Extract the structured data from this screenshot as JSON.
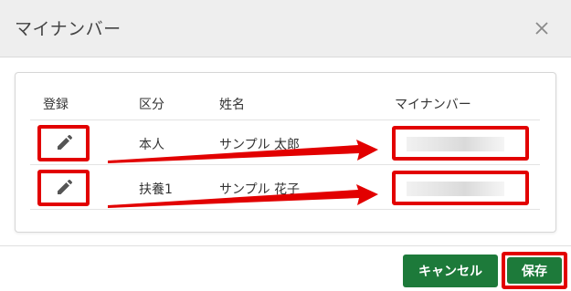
{
  "dialog": {
    "title": "マイナンバー"
  },
  "table": {
    "headers": {
      "register": "登録",
      "category": "区分",
      "name": "姓名",
      "mynumber": "マイナンバー"
    },
    "rows": [
      {
        "category": "本人",
        "name": "サンプル 太郎"
      },
      {
        "category": "扶養1",
        "name": "サンプル 花子"
      }
    ]
  },
  "footer": {
    "cancel_label": "キャンセル",
    "save_label": "保存"
  },
  "colors": {
    "primary_green": "#1d7a3a",
    "highlight_red": "#e20000"
  },
  "icons": [
    "pencil-icon",
    "close-icon"
  ]
}
